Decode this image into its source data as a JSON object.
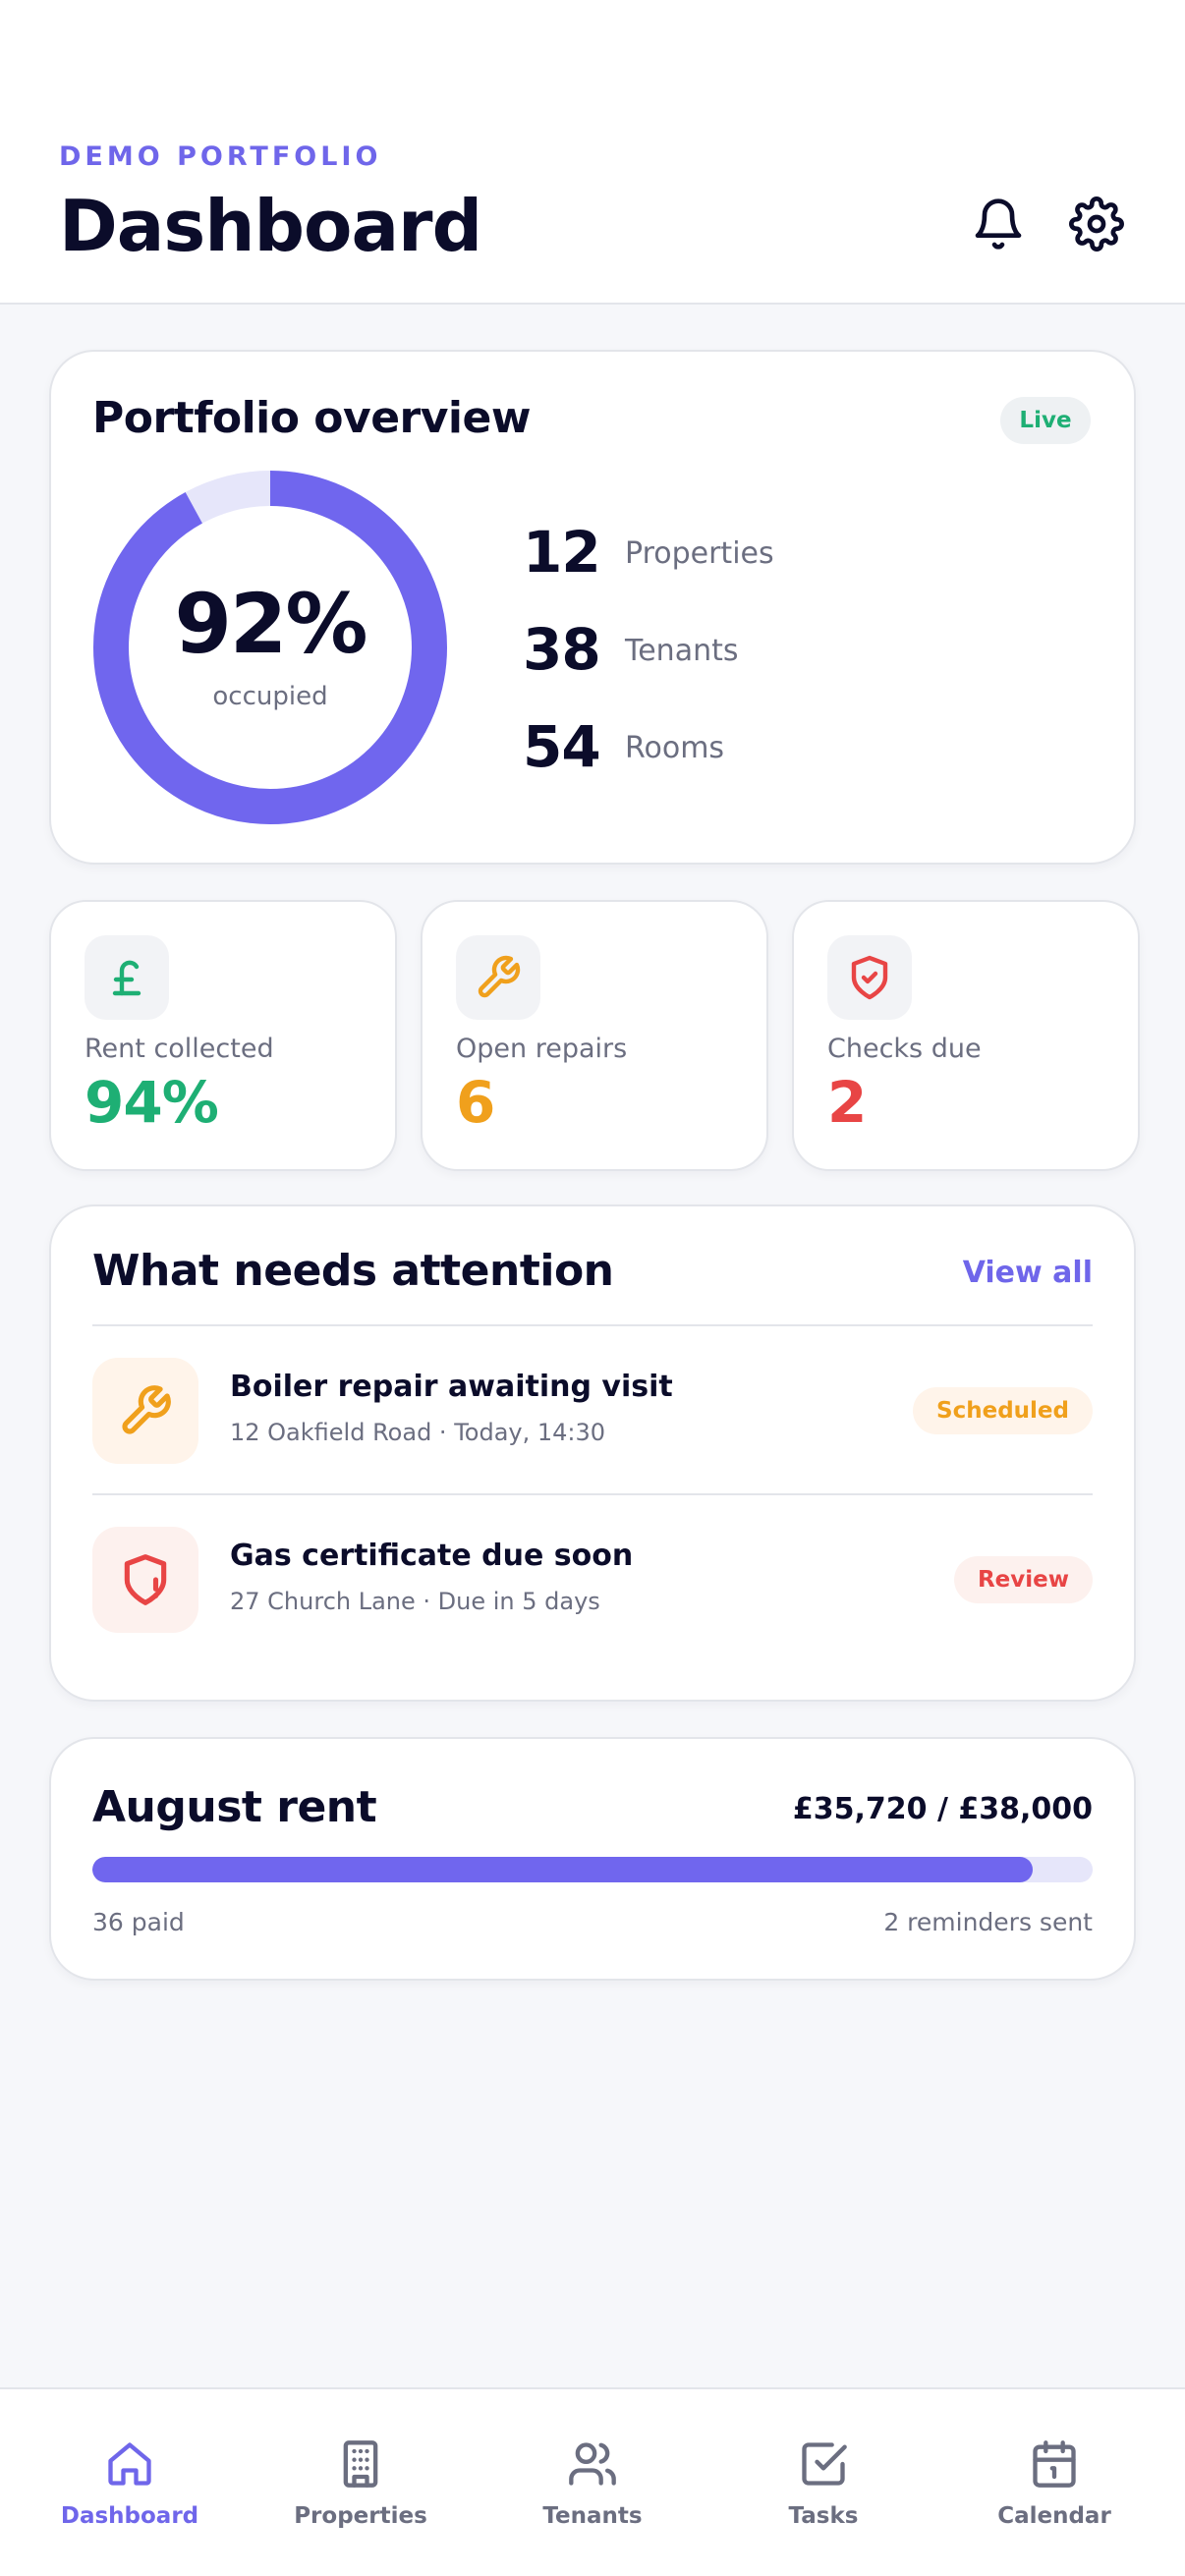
{
  "header": {
    "eyebrow": "DEMO PORTFOLIO",
    "title": "Dashboard",
    "icons": [
      "bell-icon",
      "gear-icon"
    ]
  },
  "overview": {
    "title": "Portfolio overview",
    "badge": "Live",
    "occupancy": {
      "value": 92,
      "label": "92%",
      "caption": "occupied"
    },
    "stats": [
      {
        "value": "12",
        "label": "Properties"
      },
      {
        "value": "38",
        "label": "Tenants"
      },
      {
        "value": "54",
        "label": "Rooms"
      }
    ]
  },
  "metrics": [
    {
      "icon": "pound-icon",
      "label": "Rent collected",
      "value": "94%",
      "color": "#1eaf74"
    },
    {
      "icon": "wrench-icon",
      "label": "Open repairs",
      "value": "6",
      "color": "#f0a01c"
    },
    {
      "icon": "shield-check-icon",
      "label": "Checks due",
      "value": "2",
      "color": "#e84545"
    }
  ],
  "attention": {
    "title": "What needs attention",
    "view_all": "View all",
    "items": [
      {
        "icon": "wrench-icon",
        "title": "Boiler repair awaiting visit",
        "subtitle": "12 Oakfield Road · Today, 14:30",
        "badge": "Scheduled",
        "badge_color": "#f0a01c"
      },
      {
        "icon": "shield-alert-icon",
        "title": "Gas certificate due soon",
        "subtitle": "27 Church Lane · Due in 5 days",
        "badge": "Review",
        "badge_color": "#e84545"
      }
    ]
  },
  "rent": {
    "title": "August rent",
    "amount": "£35,720 / £38,000",
    "progress": 0.94,
    "paid": "36 paid",
    "reminders": "2 reminders sent"
  },
  "nav": {
    "items": [
      {
        "label": "Dashboard",
        "icon": "home-icon",
        "active": true
      },
      {
        "label": "Properties",
        "icon": "building-icon",
        "active": false
      },
      {
        "label": "Tenants",
        "icon": "users-icon",
        "active": false
      },
      {
        "label": "Tasks",
        "icon": "checkbox-icon",
        "active": false
      },
      {
        "label": "Calendar",
        "icon": "calendar-icon",
        "active": false
      }
    ]
  },
  "colors": {
    "accent": "#6f66ea",
    "success": "#1eaf74",
    "warning": "#f0a01c",
    "danger": "#e84545"
  }
}
